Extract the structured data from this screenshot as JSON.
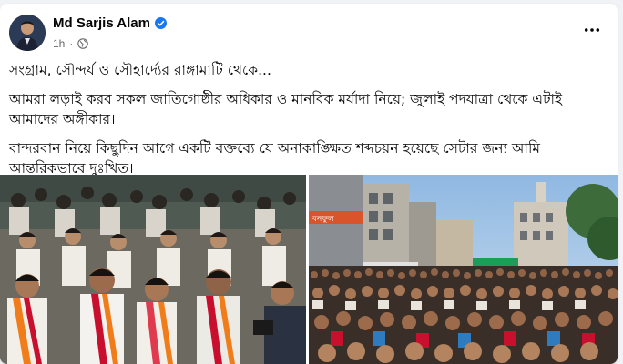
{
  "post": {
    "author": {
      "name": "Md Sarjis Alam",
      "verified": true
    },
    "meta": {
      "time": "1h",
      "separator": "·",
      "audience_icon": "globe-icon"
    },
    "more_icon": "more-horizontal-icon",
    "text": {
      "line1": "সংগ্রাম, সৌন্দর্য ও সৌহার্দ্যের রাঙ্গামাটি থেকে...",
      "line2": "আমরা লড়াই করব সকল জাতিগোষ্ঠীর অধিকার ও মানবিক মর্যাদা নিয়ে; জুলাই পদযাত্রা থেকে এটাই আমাদের অঙ্গীকার।",
      "line3": "বান্দরবান নিয়ে কিছুদিন আগে একটি বক্তব্যে যে অনাকাঙ্ক্ষিত শব্দচয়ন হয়েছে সেটার জন্য আমি আন্তরিকভাবে দুঃখিত।"
    },
    "photos": [
      {
        "name": "rally-march-photo",
        "alt_icon": "photo-icon"
      },
      {
        "name": "crowd-street-photo",
        "alt_icon": "photo-icon"
      }
    ],
    "sign_text": "বনফুল",
    "colors": {
      "verified_blue": "#1877f2",
      "meta_gray": "#65676b",
      "sash_red": "#c8102e",
      "sash_orange": "#f07d1a",
      "sky_blue": "#9ec3e6"
    }
  }
}
